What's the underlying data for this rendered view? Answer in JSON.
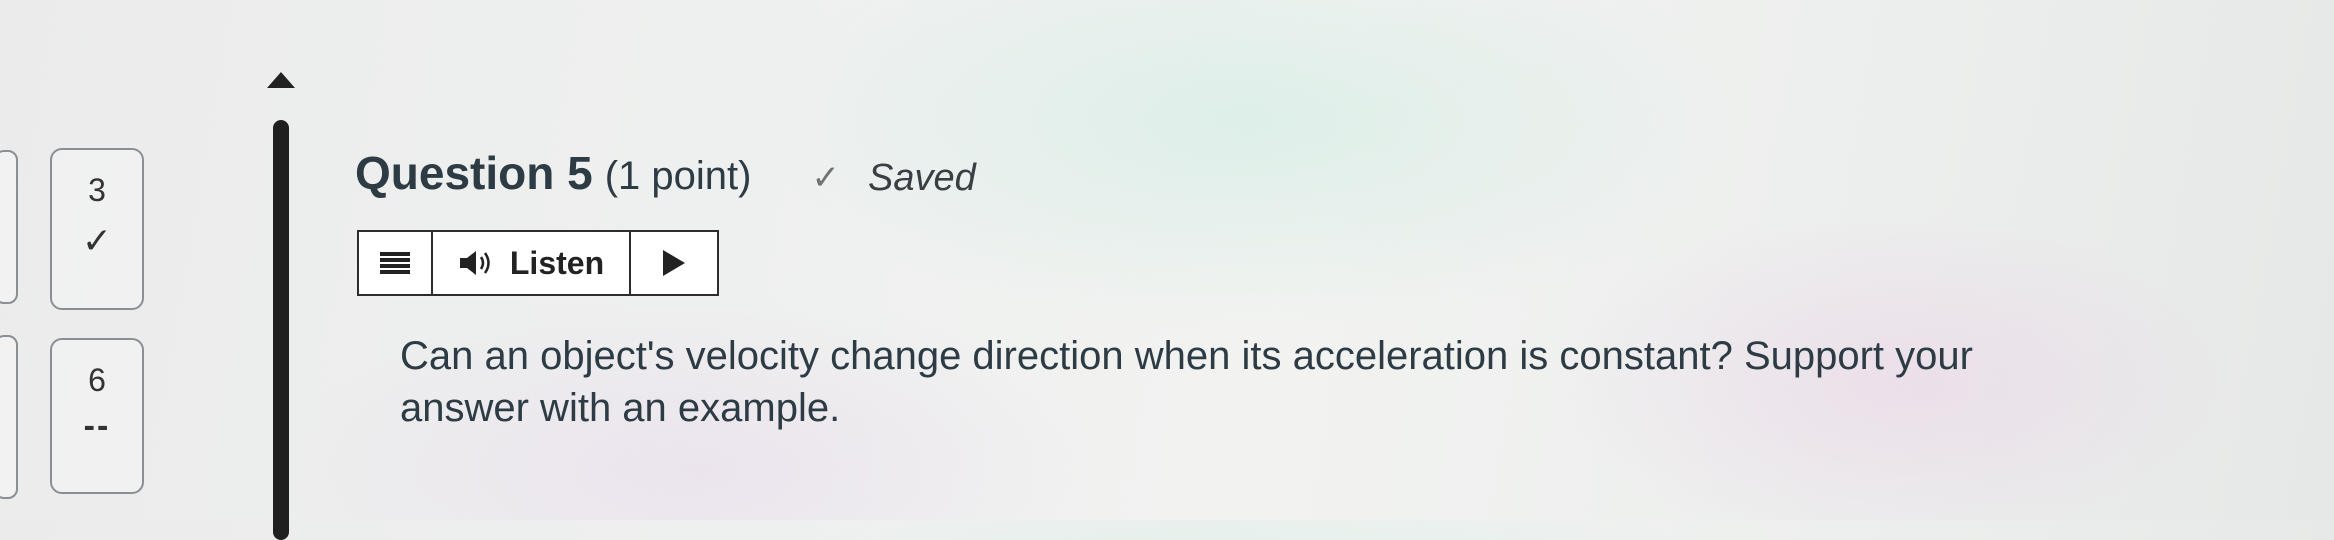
{
  "navigator": {
    "items": [
      {
        "number": "3",
        "status": "✓"
      },
      {
        "number": "6",
        "status": "--"
      }
    ]
  },
  "question": {
    "title": "Question 5",
    "points": "(1 point)",
    "saved_label": "Saved",
    "body": "Can an object's velocity change direction when its acceleration is constant? Support your answer with an example."
  },
  "toolbar": {
    "listen_label": "Listen"
  },
  "icons": {
    "menu": "menu-icon",
    "speaker": "speaker-icon",
    "play": "play-icon",
    "check": "check-icon",
    "scroll_up": "scroll-up-arrow-icon"
  }
}
